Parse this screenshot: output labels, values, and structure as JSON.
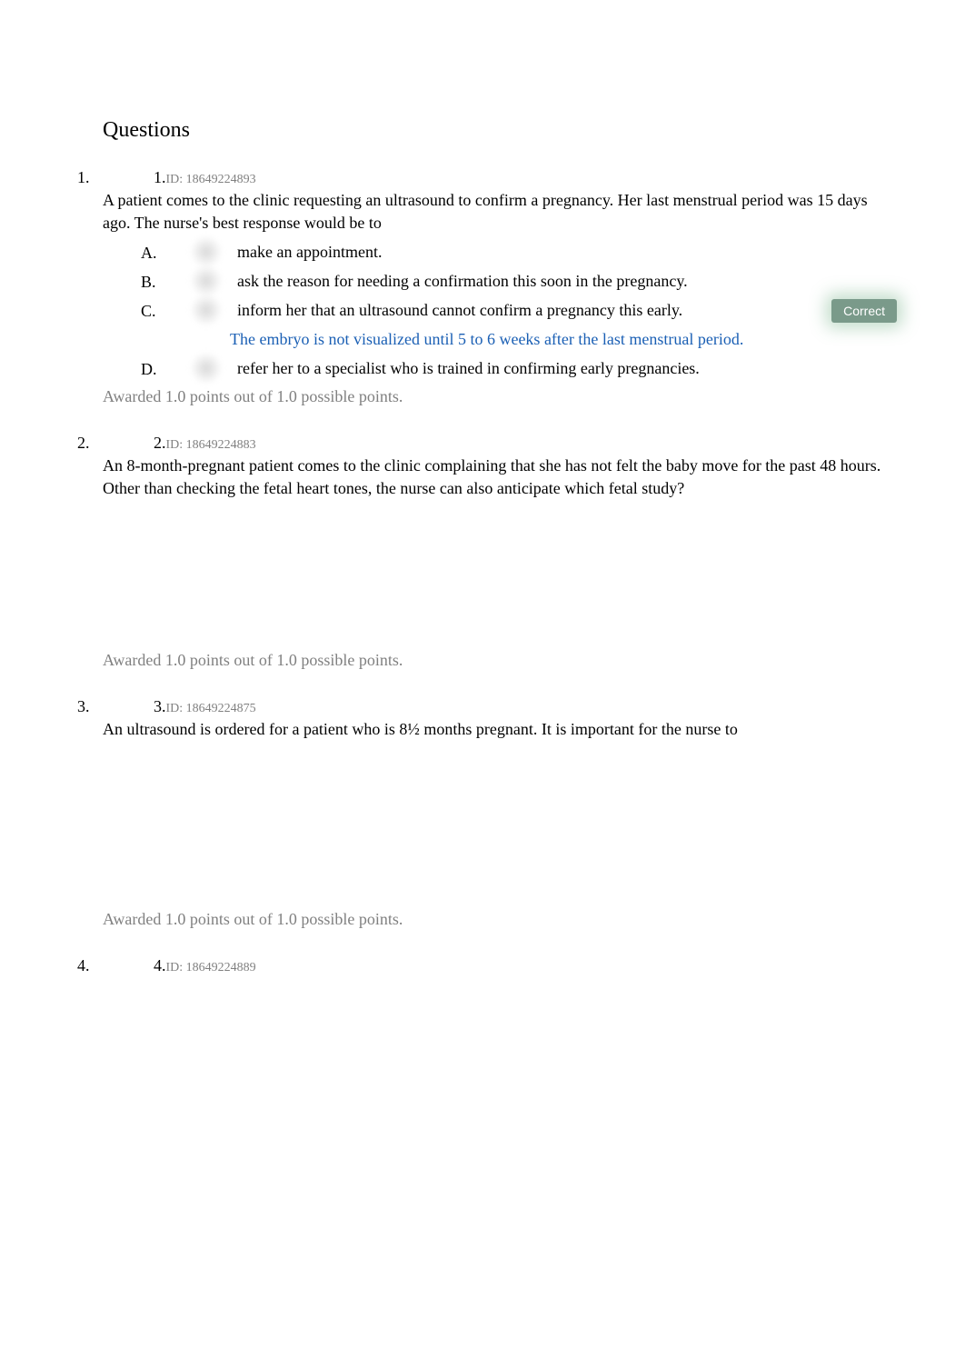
{
  "page_title": "Questions",
  "correct_label": "Correct",
  "questions": [
    {
      "number": "1.",
      "id_label": "ID: 18649224893",
      "text": "A patient comes to the clinic requesting an ultrasound to confirm a pregnancy. Her last menstrual period was 15 days ago. The nurse's best response would be to",
      "options": [
        {
          "letter": "A.",
          "text": "make an appointment."
        },
        {
          "letter": "B.",
          "text": "ask the reason for needing a confirmation this soon in the pregnancy."
        },
        {
          "letter": "C.",
          "text": "inform her that an ultrasound cannot confirm a pregnancy this early.",
          "correct": true
        },
        {
          "letter": "D.",
          "text": "refer her to a specialist who is trained in confirming early pregnancies."
        }
      ],
      "explanation": "The embryo is not visualized until 5 to 6 weeks after the last menstrual period.",
      "explanation_after_index": 2,
      "awarded": "Awarded 1.0 points out of 1.0 possible points."
    },
    {
      "number": "2.",
      "id_label": "ID: 18649224883",
      "text": "An 8-month-pregnant patient comes to the clinic complaining that she has not felt the baby move for the past 48 hours. Other than checking the fetal heart tones, the nurse can also anticipate which fetal study?",
      "awarded": "Awarded 1.0 points out of 1.0 possible points."
    },
    {
      "number": "3.",
      "id_label": "ID: 18649224875",
      "text": "An ultrasound is ordered for a patient who is 8½ months pregnant. It is important for the nurse to",
      "awarded": "Awarded 1.0 points out of 1.0 possible points."
    },
    {
      "number": "4.",
      "id_label": "ID: 18649224889"
    }
  ]
}
